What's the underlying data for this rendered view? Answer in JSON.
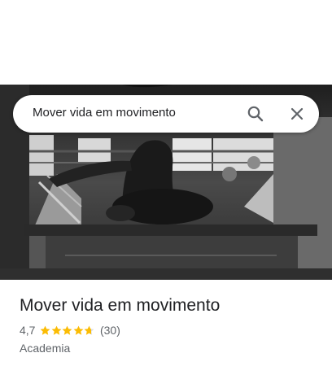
{
  "search": {
    "query": "Mover vida em movimento",
    "search_icon": "search-icon",
    "close_icon": "close-icon"
  },
  "place": {
    "name": "Mover vida em movimento",
    "rating": "4,7",
    "rating_value": 4.7,
    "stars_total": 5,
    "review_count": "(30)",
    "category": "Academia"
  },
  "colors": {
    "star": "#fbbc04",
    "star_empty": "#dadce0",
    "text_primary": "#202124",
    "text_secondary": "#5f6368"
  }
}
